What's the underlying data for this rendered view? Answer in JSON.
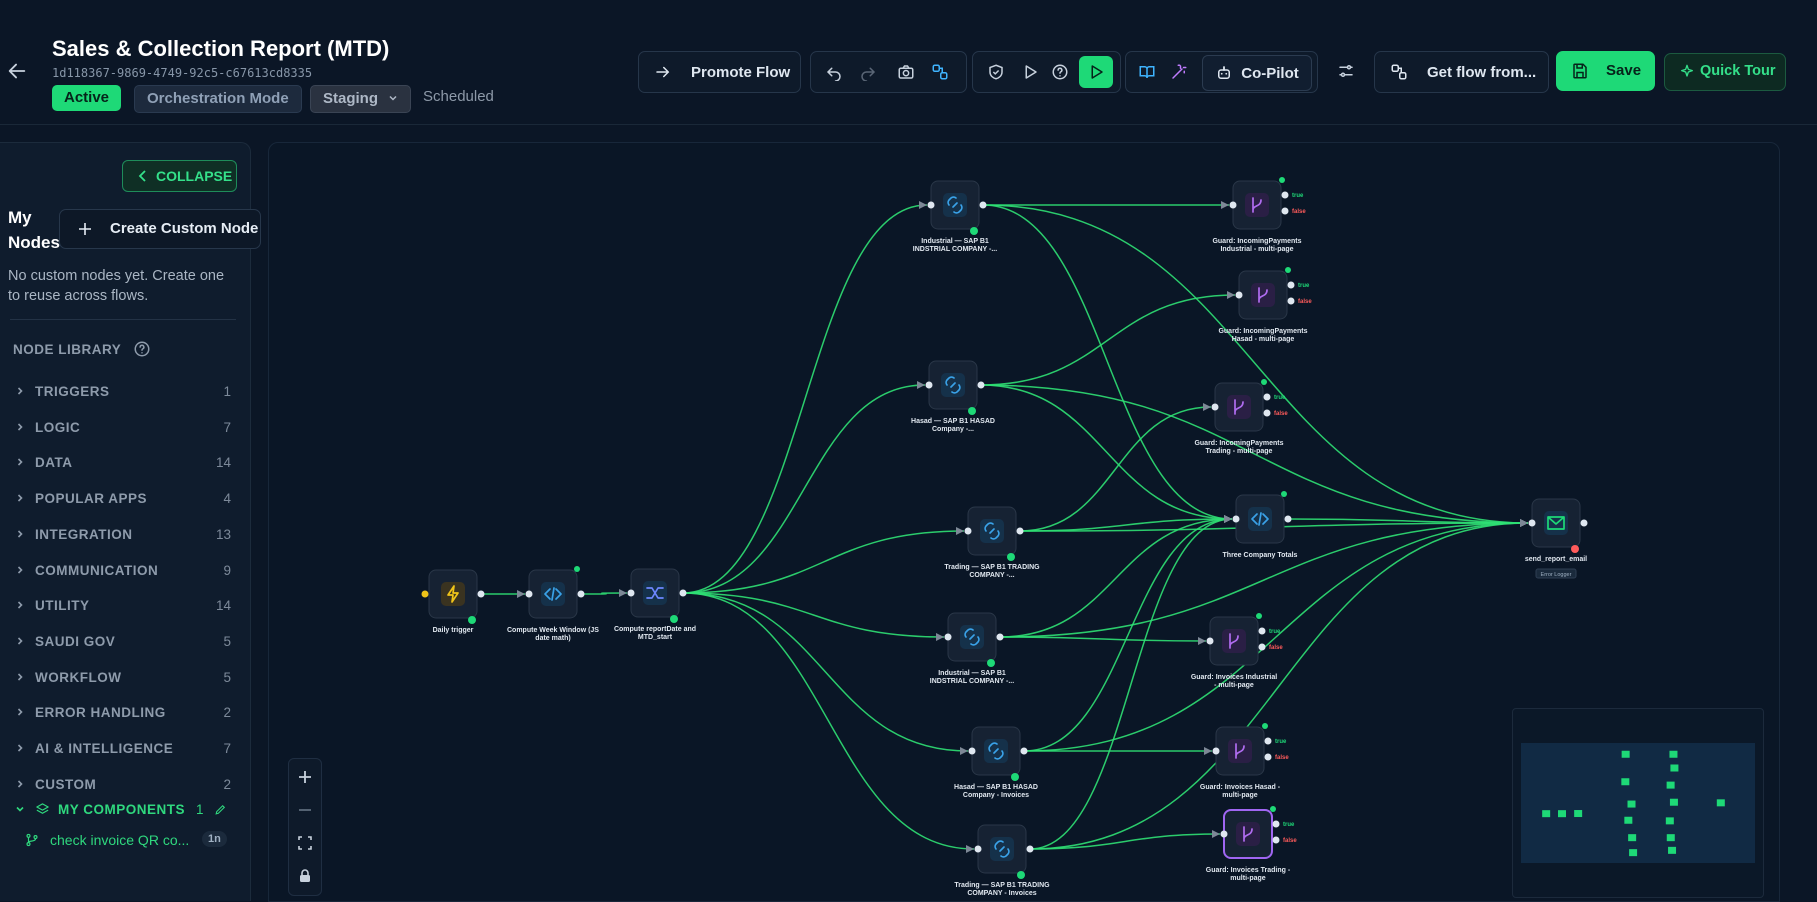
{
  "header": {
    "title": "Sales & Collection Report (MTD)",
    "flow_id": "1d118367-9869-4749-92c5-c67613cd8335",
    "status": "Active",
    "mode": "Orchestration Mode",
    "environment": "Staging",
    "schedule": "Scheduled"
  },
  "toolbar": {
    "promote": "Promote Flow",
    "copilot": "Co-Pilot",
    "get_flow": "Get flow from...",
    "save": "Save",
    "quick_tour": "Quick Tour"
  },
  "sidebar": {
    "collapse": "COLLAPSE",
    "my_nodes": "My Nodes",
    "create_custom": "Create Custom Node",
    "no_custom": "No custom nodes yet. Create one to reuse across flows.",
    "library_title": "NODE LIBRARY",
    "categories": [
      {
        "label": "TRIGGERS",
        "count": "1"
      },
      {
        "label": "LOGIC",
        "count": "7"
      },
      {
        "label": "DATA",
        "count": "14"
      },
      {
        "label": "POPULAR APPS",
        "count": "4"
      },
      {
        "label": "INTEGRATION",
        "count": "13"
      },
      {
        "label": "COMMUNICATION",
        "count": "9"
      },
      {
        "label": "UTILITY",
        "count": "14"
      },
      {
        "label": "SAUDI GOV",
        "count": "5"
      },
      {
        "label": "WORKFLOW",
        "count": "5"
      },
      {
        "label": "ERROR HANDLING",
        "count": "2"
      },
      {
        "label": "AI & INTELLIGENCE",
        "count": "7"
      },
      {
        "label": "CUSTOM",
        "count": "2"
      }
    ],
    "my_components": {
      "label": "MY COMPONENTS",
      "count": "1"
    },
    "component_item": {
      "label": "check invoice QR co...",
      "badge": "1n"
    }
  },
  "nodes": [
    {
      "id": "n1",
      "label": "Daily trigger",
      "kind": "trigger"
    },
    {
      "id": "n2",
      "label": "Compute Week Window (JS date math)",
      "kind": "code"
    },
    {
      "id": "n3",
      "label": "Compute reportDate and MTD_start",
      "kind": "transform"
    },
    {
      "id": "n4",
      "label": "Industrial — SAP B1 INDSTRIAL COMPANY -...",
      "kind": "connector"
    },
    {
      "id": "n5",
      "label": "Hasad — SAP B1 HASAD Company -...",
      "kind": "connector"
    },
    {
      "id": "n6",
      "label": "Trading — SAP B1 TRADING COMPANY -...",
      "kind": "connector"
    },
    {
      "id": "n7",
      "label": "Industrial — SAP B1 INDSTRIAL COMPANY -...",
      "kind": "connector"
    },
    {
      "id": "n8",
      "label": "Hasad — SAP B1 HASAD Company - Invoices",
      "kind": "connector"
    },
    {
      "id": "n9",
      "label": "Trading — SAP B1 TRADING COMPANY - Invoices",
      "kind": "connector"
    },
    {
      "id": "g1",
      "label": "Guard: IncomingPayments Industrial - multi-page",
      "kind": "guard"
    },
    {
      "id": "g2",
      "label": "Guard: IncomingPayments Hasad - multi-page",
      "kind": "guard"
    },
    {
      "id": "g3",
      "label": "Guard: IncomingPayments Trading - multi-page",
      "kind": "guard"
    },
    {
      "id": "g4",
      "label": "Guard: Invoices Industrial - multi-page",
      "kind": "guard"
    },
    {
      "id": "g5",
      "label": "Guard: Invoices Hasad - multi-page",
      "kind": "guard"
    },
    {
      "id": "g6",
      "label": "Guard: Invoices Trading - multi-page",
      "kind": "guard"
    },
    {
      "id": "t1",
      "label": "Three Company Totals",
      "kind": "code"
    },
    {
      "id": "e1",
      "label": "send_report_email",
      "kind": "email",
      "tag": "Error Logger"
    }
  ],
  "guard_ports": {
    "true": "true",
    "false": "false"
  },
  "colors": {
    "accent": "#1ed977",
    "edge": "#2fe074",
    "guard_icon": "#b06cf0",
    "code_icon": "#3aa2e8",
    "trigger_icon": "#f0c419",
    "false_port": "#ff5b5b"
  }
}
